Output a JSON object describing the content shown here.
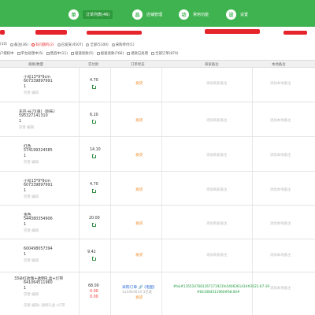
{
  "nav": [
    {
      "glyph": "单",
      "label": "订单列表(46)",
      "active": true
    },
    {
      "glyph": "品",
      "label": "店铺管理",
      "active": false
    },
    {
      "glyph": "功",
      "label": "常用功能",
      "active": false
    },
    {
      "glyph": "设",
      "label": "设置",
      "active": false
    }
  ],
  "filters": {
    "row1": [
      "(10)",
      "备注(36)",
      "有问题的(2)",
      "已发货(4507)",
      "全部(5100)",
      "采购单付(1)"
    ],
    "row2": [
      "户授权中",
      "平台处理中(5)",
      "售后中(11)",
      "极速退款(5)",
      "极速退款(766)",
      "退款已处理",
      "全部订单(870)"
    ]
  },
  "table_headers": [
    "规格/数量",
    "实付款",
    "订单状态",
    "商家备注",
    "本地备注"
  ],
  "rows": [
    {
      "spec": "小号13*9*9cm",
      "code": "607339897991",
      "qty": "1",
      "actions": "完善 编辑",
      "price": "4.70",
      "status": "发货",
      "seller_note": "添加商家备注",
      "local_note": "添加本地备注"
    },
    {
      "spec": "东巴-长刀(单)（刺布）",
      "code": "595327141310",
      "qty": "1",
      "actions": "完善 编辑",
      "price": "6.20",
      "status": "发货",
      "seller_note": "添加商家备注",
      "local_note": "添加本地备注"
    },
    {
      "spec": "红色",
      "code": "574199324585",
      "qty": "1",
      "actions": "完善 编辑",
      "price": "14.10",
      "status": "发货",
      "seller_note": "添加商家备注",
      "local_note": "添加本地备注"
    },
    {
      "spec": "小号13*9*9cm",
      "code": "607339897991",
      "qty": "1",
      "actions": "完善 编辑",
      "price": "4.70",
      "status": "发货",
      "seller_note": "添加商家备注",
      "local_note": "添加本地备注"
    },
    {
      "spec": "金色",
      "code": "544380354906",
      "qty": "1",
      "actions": "完善 编辑",
      "price": "20.00",
      "status": "发货",
      "seller_note": "添加商家备注",
      "local_note": "添加本地备注"
    },
    {
      "spec": "",
      "code": "600498057394",
      "qty": "1",
      "actions": "完善 编辑",
      "price": "9.42",
      "status": "发货",
      "seller_note": "添加商家备注",
      "local_note": "添加本地备注"
    }
  ],
  "last_row": {
    "spec": "33朵红玫瑰+透明礼盒+灯带",
    "code": "641064511960",
    "qty": "1",
    "actions": "完善 编辑",
    "sub_actions": "完善 编辑+透明礼盒+灯带",
    "price": "68.00",
    "price2": "0.00",
    "price3": "0.00",
    "status_link": "采购订单 🔗 (电图)",
    "status_sub1": "1a5463614 3已发",
    "status_sub2": "发货",
    "seller_note": "#h&#1355107681167171921fe5406361434#2021-07-19",
    "seller_note2": "#641084511960#68.00#",
    "local_note": "添加本地备注"
  },
  "colors": {
    "header_green": "#3fb34f",
    "redact_red": "#e5242b",
    "status_orange": "#f08a24"
  }
}
